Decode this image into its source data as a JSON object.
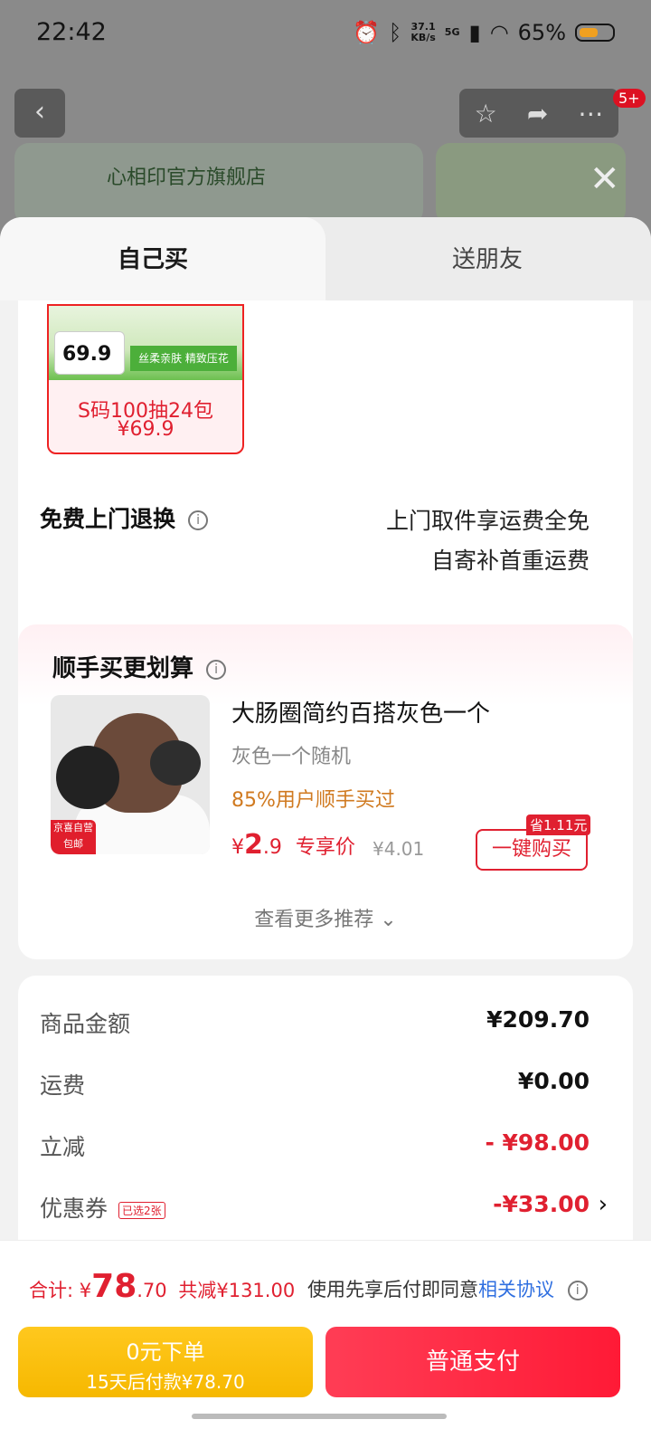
{
  "status_bar": {
    "time": "22:42",
    "net_speed_value": "37.1",
    "net_speed_unit": "KB/s",
    "network": "5G",
    "battery": "65%",
    "icons": [
      "alarm-icon",
      "bluetooth-icon",
      "signal-icon",
      "wifi-icon",
      "battery-icon"
    ]
  },
  "background_page": {
    "back_icon": "‹",
    "cart_badge": "5+",
    "store_name": "心相印官方旗舰店"
  },
  "tabs": [
    {
      "label": "自己买",
      "active": true
    },
    {
      "label": "送朋友",
      "active": false
    }
  ],
  "product": {
    "thumb_price": "69.9",
    "thumb_slogan": "丝柔亲肤 精致压花",
    "sku_name": "S码100抽24包",
    "sku_price": "¥69.9"
  },
  "returns": {
    "title": "免费上门退换",
    "line1": "上门取件享运费全免",
    "line2": "自寄补首重运费"
  },
  "recommend": {
    "title": "顺手买更划算",
    "item_name": "大肠圈简约百搭灰色一个",
    "item_spec": "灰色一个随机",
    "buyers": "85%用户顺手买过",
    "price_symbol": "¥",
    "price_int": "2",
    "price_dec": ".9",
    "price_label": "专享价",
    "original_price": "¥4.01",
    "save_badge": "省1.11元",
    "buy_button": "一键购买",
    "tag_line1": "京喜自营",
    "tag_line2": "包邮",
    "more": "查看更多推荐"
  },
  "summary": {
    "rows": [
      {
        "label": "商品金额",
        "value": "¥209.70"
      },
      {
        "label": "运费",
        "value": "¥0.00"
      },
      {
        "label": "立减",
        "value": "- ¥98.00"
      },
      {
        "label": "优惠券",
        "value": "-¥33.00",
        "tag": "已选2张"
      }
    ]
  },
  "footer": {
    "total_label": "合计:",
    "total_symbol": "¥",
    "total_int": "78",
    "total_dec": ".70",
    "total_saved": "共减¥131.00",
    "agree_text": "使用先享后付即同意",
    "agree_link": "相关协议",
    "btn_later_line1": "0元下单",
    "btn_later_line2": "15天后付款¥78.70",
    "btn_pay": "普通支付"
  },
  "colors": {
    "accent_red": "#e02030",
    "pay_yellow": "#f6b800",
    "link_blue": "#2f6fe0"
  }
}
